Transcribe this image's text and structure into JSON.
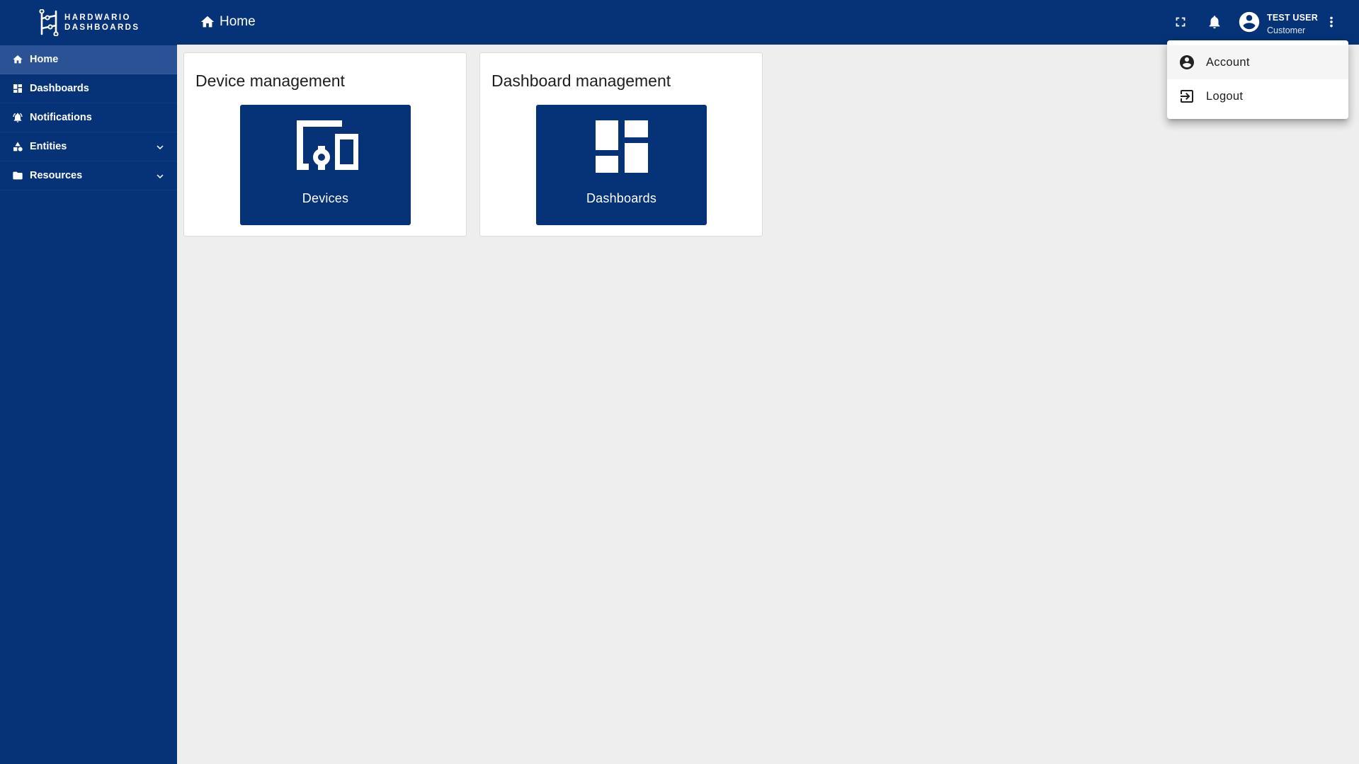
{
  "app": {
    "logo_line1": "HARDWARIO",
    "logo_line2": "DASHBOARDS",
    "brand_color": "#063378",
    "accent_color": "#2a5294"
  },
  "sidebar": {
    "items": [
      {
        "label": "Home",
        "icon": "home-icon",
        "active": true
      },
      {
        "label": "Dashboards",
        "icon": "dashboard-icon"
      },
      {
        "label": "Notifications",
        "icon": "notification-icon"
      },
      {
        "label": "Entities",
        "icon": "entities-icon",
        "expandable": true
      },
      {
        "label": "Resources",
        "icon": "folder-icon",
        "expandable": true
      }
    ]
  },
  "header": {
    "breadcrumb": "Home",
    "user_name": "TEST USER",
    "user_role": "Customer"
  },
  "main": {
    "cards": [
      {
        "title": "Device management",
        "tile_label": "Devices",
        "icon": "devices-icon"
      },
      {
        "title": "Dashboard management",
        "tile_label": "Dashboards",
        "icon": "dashboard-icon"
      }
    ]
  },
  "user_menu": {
    "items": [
      {
        "label": "Account",
        "icon": "account-circle-icon"
      },
      {
        "label": "Logout",
        "icon": "logout-icon"
      }
    ]
  }
}
